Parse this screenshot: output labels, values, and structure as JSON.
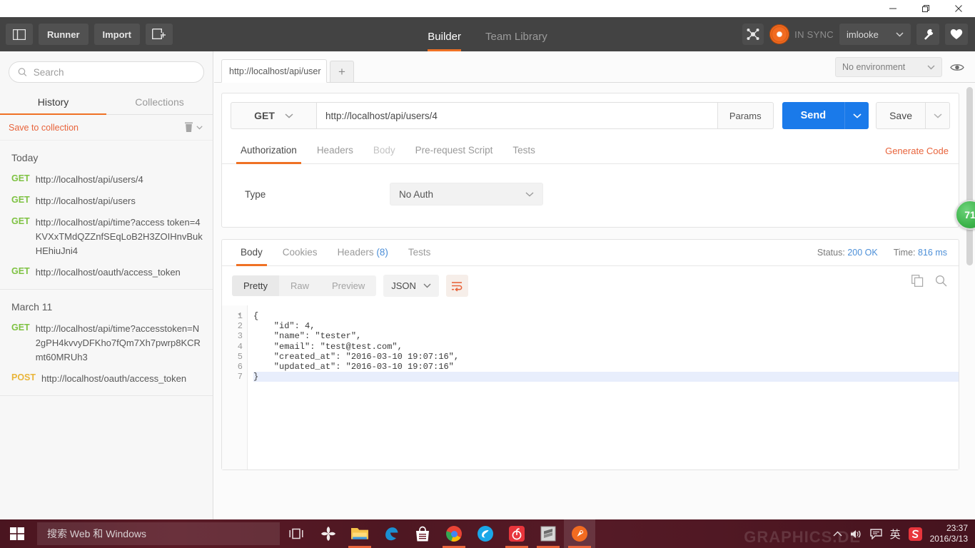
{
  "window": {
    "minimize": "minimize-icon",
    "maximize": "restore-icon",
    "close": "close-icon"
  },
  "topbar": {
    "sidebar_toggle_icon": "panel-toggle-icon",
    "runner_label": "Runner",
    "import_label": "Import",
    "new_tab_icon": "new-window-icon",
    "tabs": [
      {
        "label": "Builder",
        "active": true
      },
      {
        "label": "Team Library",
        "active": false
      }
    ],
    "node_icon": "network-node-icon",
    "sync_status": "IN SYNC",
    "user": "imlooke",
    "wrench_icon": "wrench-icon",
    "heart_icon": "heart-icon"
  },
  "sidebar": {
    "search": {
      "placeholder": "Search",
      "value": ""
    },
    "tabs": [
      {
        "label": "History",
        "active": true
      },
      {
        "label": "Collections",
        "active": false
      }
    ],
    "save_to_collection": "Save to collection",
    "trash_icon": "trash-icon",
    "groups": [
      {
        "date": "Today",
        "items": [
          {
            "method": "GET",
            "url": "http://localhost/api/users/4"
          },
          {
            "method": "GET",
            "url": "http://localhost/api/users"
          },
          {
            "method": "GET",
            "url": "http://localhost/api/time?access token=4KVXxTMdQZZnfSEqLoB2H3ZOIHnvBukHEhiuJni4"
          },
          {
            "method": "GET",
            "url": "http://localhost/oauth/access_token"
          }
        ]
      },
      {
        "date": "March 11",
        "items": [
          {
            "method": "GET",
            "url": "http://localhost/api/time?accesstoken=N2gPH4kvvyDFKho7fQm7Xh7pwrp8KCRmt60MRUh3"
          },
          {
            "method": "POST",
            "url": "http://localhost/oauth/access_token"
          }
        ]
      }
    ]
  },
  "main": {
    "request_tab_label": "http://localhost/api/user",
    "add_tab_label": "+",
    "environment": "No environment",
    "eye_icon": "eye-icon",
    "request": {
      "method": "GET",
      "url": "http://localhost/api/users/4",
      "params_label": "Params",
      "send_label": "Send",
      "save_label": "Save",
      "tabs": [
        {
          "label": "Authorization",
          "active": true,
          "dim": false
        },
        {
          "label": "Headers",
          "active": false,
          "dim": false
        },
        {
          "label": "Body",
          "active": false,
          "dim": true
        },
        {
          "label": "Pre-request Script",
          "active": false,
          "dim": false
        },
        {
          "label": "Tests",
          "active": false,
          "dim": false
        }
      ],
      "generate_code": "Generate Code",
      "auth": {
        "type_label": "Type",
        "type_value": "No Auth"
      }
    },
    "response": {
      "tabs": [
        {
          "label": "Body",
          "count": "",
          "active": true
        },
        {
          "label": "Cookies",
          "count": "",
          "active": false
        },
        {
          "label": "Headers",
          "count": "(8)",
          "active": false
        },
        {
          "label": "Tests",
          "count": "",
          "active": false
        }
      ],
      "status_label": "Status:",
      "status_value": "200 OK",
      "time_label": "Time:",
      "time_value": "816 ms",
      "view_modes": [
        {
          "label": "Pretty",
          "active": true
        },
        {
          "label": "Raw",
          "active": false
        },
        {
          "label": "Preview",
          "active": false
        }
      ],
      "format": "JSON",
      "wrap_icon": "word-wrap-icon",
      "copy_icon": "copy-icon",
      "search_icon": "search-icon",
      "code_lines": [
        {
          "n": "1",
          "text": "{",
          "fold": true
        },
        {
          "n": "2",
          "text": "    \"id\": 4,"
        },
        {
          "n": "3",
          "text": "    \"name\": \"tester\","
        },
        {
          "n": "4",
          "text": "    \"email\": \"test@test.com\","
        },
        {
          "n": "5",
          "text": "    \"created_at\": \"2016-03-10 19:07:16\","
        },
        {
          "n": "6",
          "text": "    \"updated_at\": \"2016-03-10 19:07:16\""
        },
        {
          "n": "7",
          "text": "}",
          "selected": true
        }
      ]
    },
    "badge_count": "71"
  },
  "taskbar": {
    "start_icon": "windows-start-icon",
    "search_placeholder": "搜索 Web 和 Windows",
    "task_view_icon": "task-view-icon",
    "apps": [
      {
        "name": "pinwheel-app-icon"
      },
      {
        "name": "file-explorer-icon"
      },
      {
        "name": "edge-browser-icon"
      },
      {
        "name": "store-icon"
      },
      {
        "name": "chrome-browser-icon"
      },
      {
        "name": "baidu-browser-icon"
      },
      {
        "name": "netease-music-icon"
      },
      {
        "name": "sublime-text-icon"
      },
      {
        "name": "postman-icon"
      }
    ],
    "tray": {
      "chevron_up_icon": "show-hidden-icons",
      "volume_icon": "volume-icon",
      "action_center_icon": "action-center-icon",
      "ime_label": "英",
      "sogou_icon": "sogou-input-icon"
    },
    "clock_time": "23:37",
    "clock_date": "2016/3/13",
    "watermark": "GRAPHICS.DE"
  },
  "colors": {
    "accent_orange": "#ef7125",
    "send_blue": "#1a7aea",
    "get_green": "#7ec242",
    "post_yellow": "#e9b53a",
    "status_blue": "#4c8fd8",
    "topbar_dark": "#434343",
    "taskbar_maroon": "#4e1722"
  }
}
